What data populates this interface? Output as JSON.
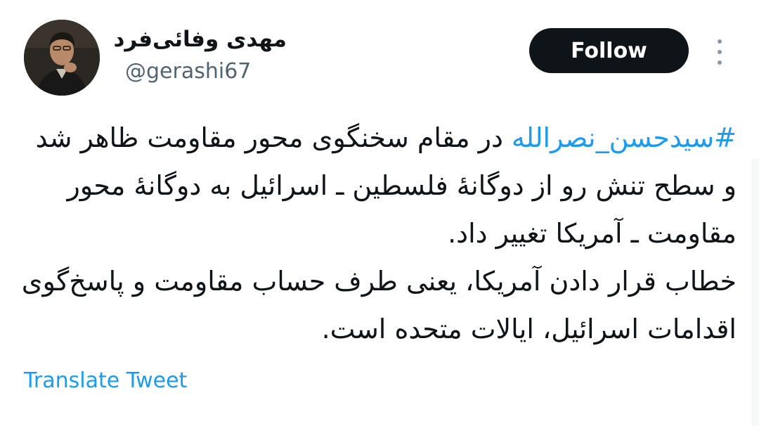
{
  "author": {
    "display_name": "مهدی وفائی‌فرد",
    "handle": "@gerashi67",
    "avatar_icon": "profile-photo"
  },
  "actions": {
    "follow_label": "Follow",
    "more_icon": "vertical-ellipsis-icon"
  },
  "tweet": {
    "hashtag": "#سیدحسن_نصرالله",
    "paragraph1_rest": " در مقام سخنگوی محور مقاومت ظاهر شد و سطح تنش رو از دوگانهٔ فلسطین ـ اسرائیل به دوگانهٔ محور مقاومت ـ آمریکا تغییر داد.",
    "paragraph2": "خطاب قرار دادن آمریکا، یعنی طرف حساب مقاومت و پاسخ‌گوی اقدامات اسرائیل، ایالات متحده است."
  },
  "translate_label": "Translate Tweet",
  "colors": {
    "link": "#1d9bf0",
    "text": "#0f1419",
    "secondary": "#536471",
    "button": "#0f1419"
  }
}
